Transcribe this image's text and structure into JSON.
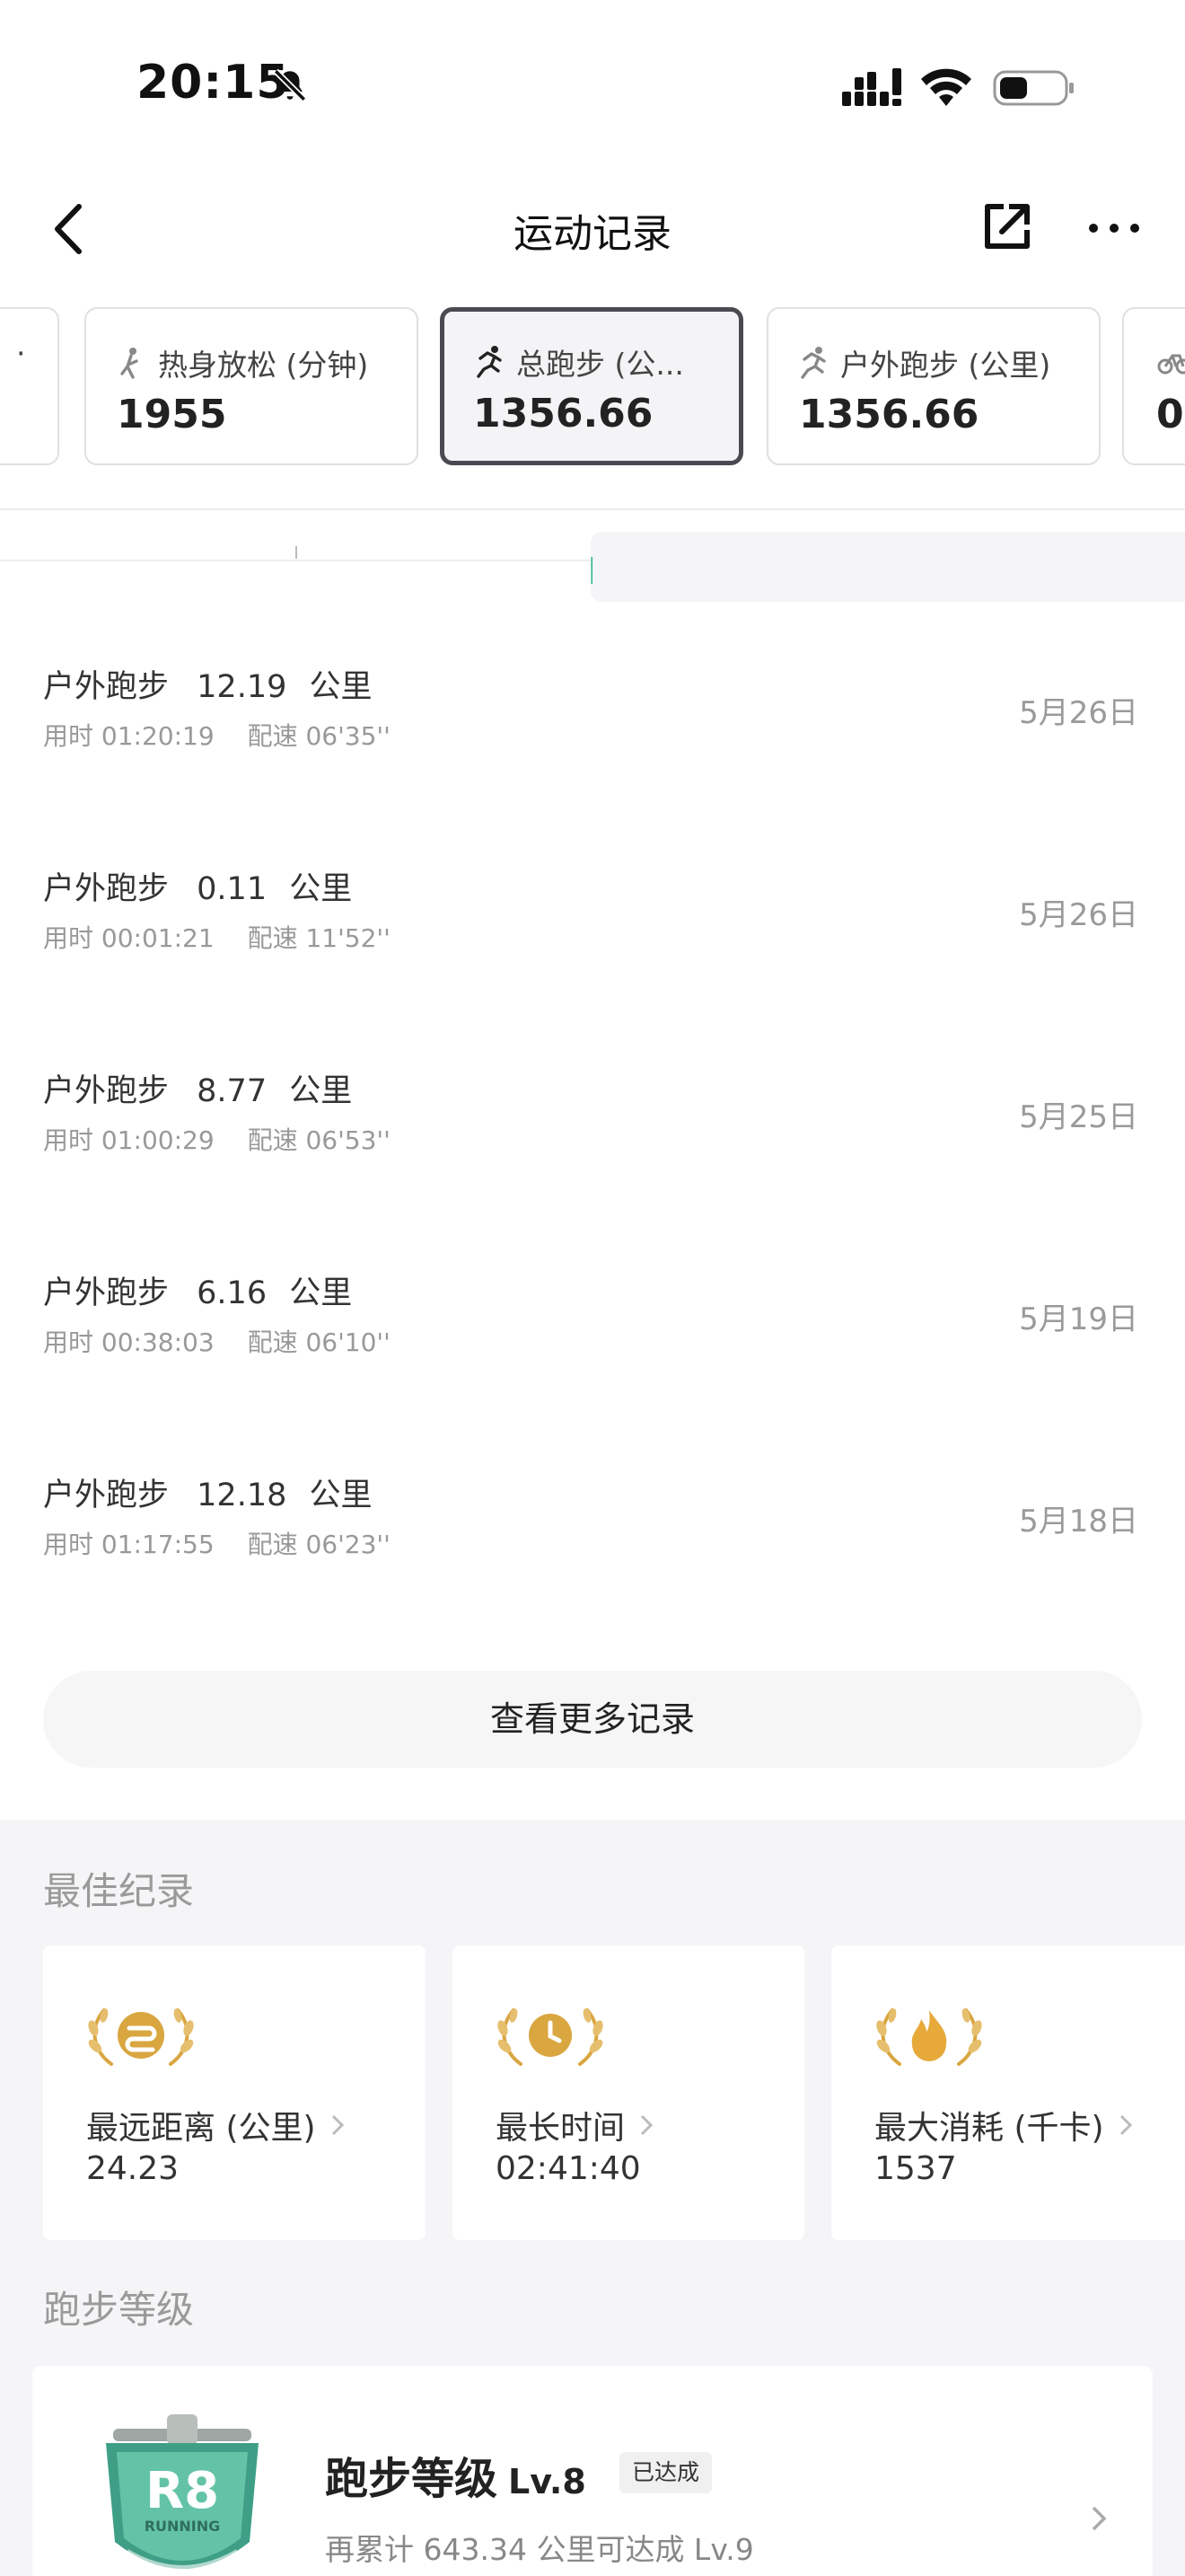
{
  "status": {
    "time": "20:15"
  },
  "header": {
    "title": "运动记录"
  },
  "chips": [
    {
      "label": "热身放松 (分钟)",
      "value": "1955"
    },
    {
      "label": "总跑步 (公...",
      "value": "1356.66"
    },
    {
      "label": "户外跑步 (公里)",
      "value": "1356.66"
    },
    {
      "label": "",
      "value": "0."
    }
  ],
  "records": [
    {
      "title": "户外跑步",
      "distance": "12.19",
      "unit": "公里",
      "duration": "用时 01:20:19",
      "pace": "配速 06'35''",
      "date": "5月26日"
    },
    {
      "title": "户外跑步",
      "distance": "0.11",
      "unit": "公里",
      "duration": "用时 00:01:21",
      "pace": "配速 11'52''",
      "date": "5月26日"
    },
    {
      "title": "户外跑步",
      "distance": "8.77",
      "unit": "公里",
      "duration": "用时 01:00:29",
      "pace": "配速 06'53''",
      "date": "5月25日"
    },
    {
      "title": "户外跑步",
      "distance": "6.16",
      "unit": "公里",
      "duration": "用时 00:38:03",
      "pace": "配速 06'10''",
      "date": "5月19日"
    },
    {
      "title": "户外跑步",
      "distance": "12.18",
      "unit": "公里",
      "duration": "用时 01:17:55",
      "pace": "配速 06'23''",
      "date": "5月18日"
    }
  ],
  "more_records_label": "查看更多记录",
  "best": {
    "title": "最佳纪录",
    "items": [
      {
        "label": "最远距离 (公里)",
        "value": "24.23",
        "icon": "route-icon"
      },
      {
        "label": "最长时间",
        "value": "02:41:40",
        "icon": "clock-icon"
      },
      {
        "label": "最大消耗 (千卡)",
        "value": "1537",
        "icon": "flame-icon"
      }
    ]
  },
  "level": {
    "section_title": "跑步等级",
    "title": "跑步等级",
    "level": "Lv.8",
    "tag": "已达成",
    "subtitle": "再累计 643.34 公里可达成 Lv.9",
    "badge_text": "R8",
    "badge_sub": "RUNNING"
  },
  "colors": {
    "accent_gold": "#d9a640",
    "badge_green": "#4fb99a",
    "timeline_green": "#2bb38a"
  }
}
